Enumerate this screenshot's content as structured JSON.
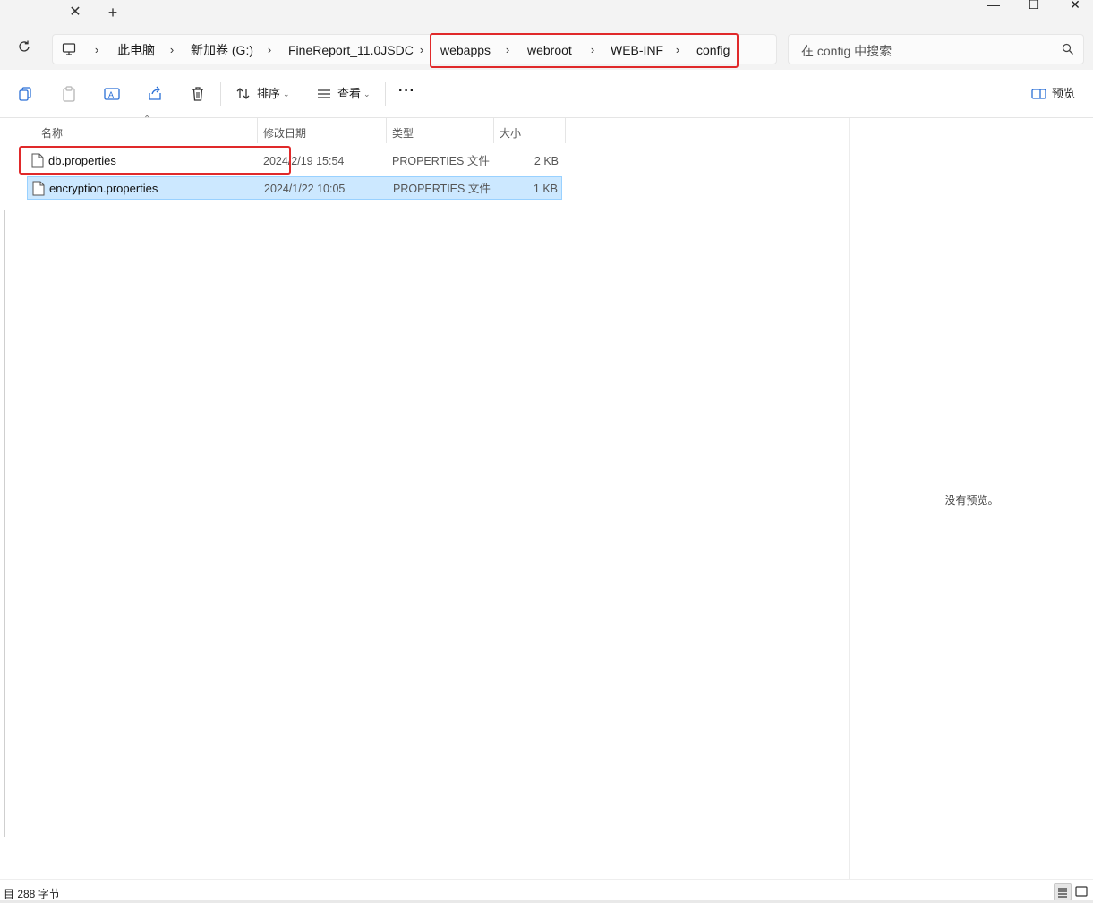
{
  "window": {
    "tab_close": "✕",
    "tab_new": "+",
    "minimize": "—",
    "maximize": "☐",
    "close": "✕"
  },
  "nav": {
    "refresh_icon": "refresh-icon",
    "breadcrumb": [
      "此电脑",
      "新加卷 (G:)",
      "FineReport_11.0JSDC",
      "webapps",
      "webroot",
      "WEB-INF",
      "config"
    ],
    "separator": "›",
    "search_placeholder": "在 config 中搜索"
  },
  "toolbar": {
    "sort_label": "排序",
    "view_label": "查看",
    "more_label": "···",
    "preview_label": "预览"
  },
  "columns": {
    "name": "名称",
    "date": "修改日期",
    "type": "类型",
    "size": "大小"
  },
  "files": [
    {
      "name": "db.properties",
      "date": "2024/2/19 15:54",
      "type": "PROPERTIES 文件",
      "size": "2 KB"
    },
    {
      "name": "encryption.properties",
      "date": "2024/1/22 10:05",
      "type": "PROPERTIES 文件",
      "size": "1 KB"
    }
  ],
  "preview": {
    "empty_text": "没有预览。"
  },
  "status": {
    "text": "目  288 字节"
  },
  "colors": {
    "highlight": "#e0292a",
    "selected_bg": "#cce8ff",
    "selected_border": "#99d1ff",
    "chrome_bg": "#f3f3f3"
  }
}
